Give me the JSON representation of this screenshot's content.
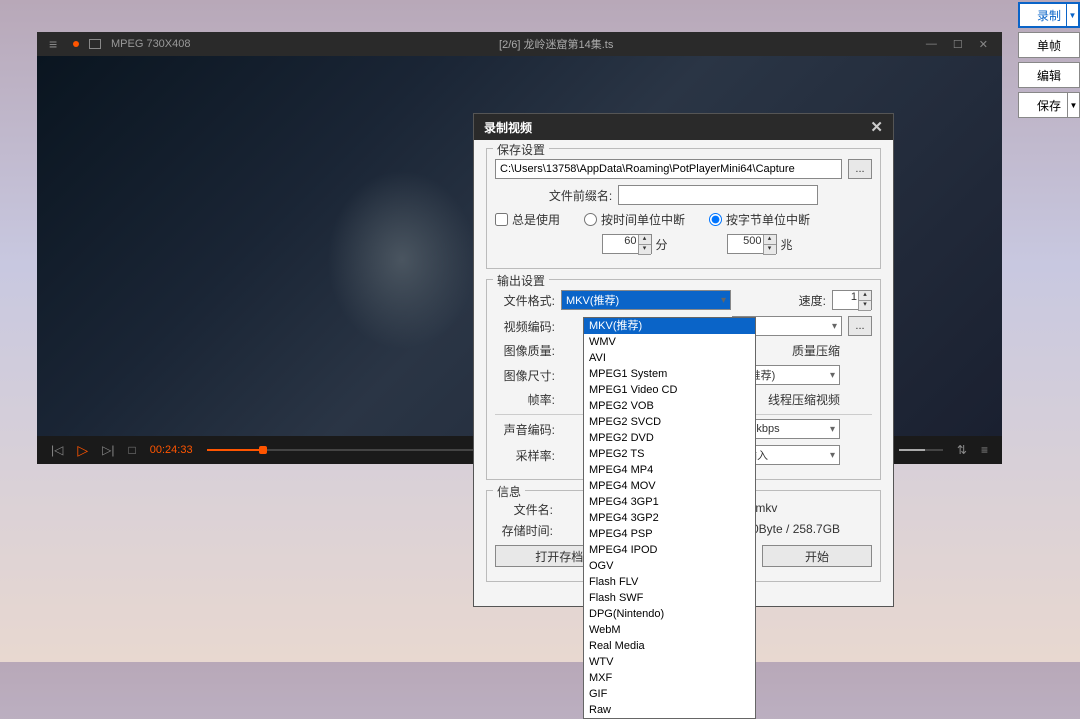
{
  "player": {
    "format_label": "MPEG 730X408",
    "title": "[2/6] 龙岭迷窟第14集.ts",
    "time_elapsed": "00:24:33",
    "progress_percent": 8
  },
  "dialog": {
    "title": "录制视频",
    "save_group": "保存设置",
    "path": "C:\\Users\\13758\\AppData\\Roaming\\PotPlayerMini64\\Capture",
    "browse": "...",
    "prefix_label": "文件前缀名:",
    "prefix_value": "",
    "always_use": "总是使用",
    "break_time": "按时间单位中断",
    "break_size": "按字节单位中断",
    "time_value": "60",
    "time_unit": "分",
    "size_value": "500",
    "size_unit": "兆",
    "output_group": "输出设置",
    "file_format_label": "文件格式:",
    "file_format_value": "MKV(推荐)",
    "speed_label": "速度:",
    "speed_value": "1",
    "video_codec_label": "视频编码:",
    "video_codec_partial": "",
    "codec_btn": "...",
    "image_quality_label": "图像质量:",
    "image_quality_partial": "质量压缩",
    "image_size_label": "图像尺寸:",
    "image_size_partial": "比(推荐)",
    "fps_label": "帧率:",
    "fps_partial": "线程压缩视频",
    "audio_codec_label": "声音编码:",
    "audio_bitrate": "128 kbps",
    "sample_rate_label": "采样率:",
    "sample_rate_value": "源输入",
    "info_group": "信息",
    "file_name_label": "文件名:",
    "file_name_value": ".mkv",
    "storage_label": "存储时间:",
    "storage_value": "0Byte / 258.7GB",
    "open_folder": "打开存档",
    "start": "开始"
  },
  "dropdown_items": [
    "MKV(推荐)",
    "WMV",
    "AVI",
    "MPEG1 System",
    "MPEG1 Video CD",
    "MPEG2 VOB",
    "MPEG2 SVCD",
    "MPEG2 DVD",
    "MPEG2 TS",
    "MPEG4 MP4",
    "MPEG4 MOV",
    "MPEG4 3GP1",
    "MPEG4 3GP2",
    "MPEG4 PSP",
    "MPEG4 IPOD",
    "OGV",
    "Flash FLV",
    "Flash SWF",
    "DPG(Nintendo)",
    "WebM",
    "Real Media",
    "WTV",
    "MXF",
    "GIF",
    "Raw"
  ],
  "right_toolbar": {
    "record": "录制",
    "single": "单帧",
    "edit": "编辑",
    "save": "保存"
  },
  "chart_data": null
}
